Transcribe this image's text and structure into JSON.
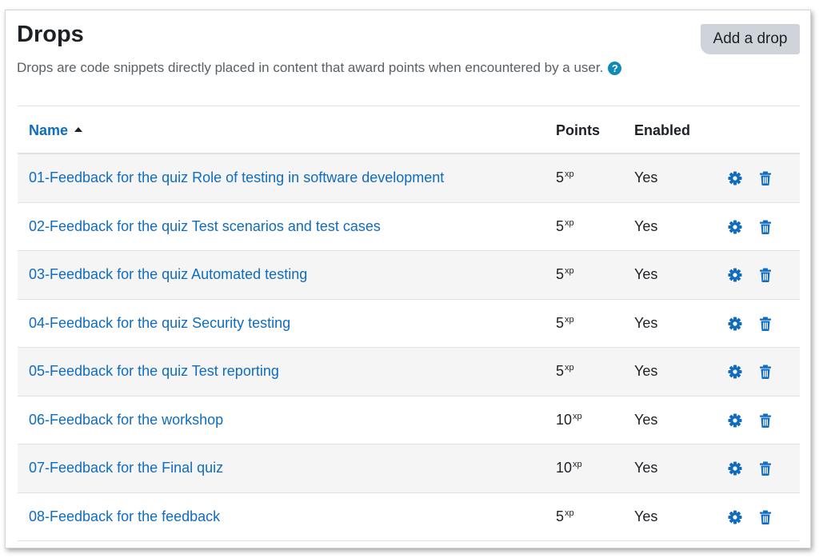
{
  "page": {
    "title": "Drops",
    "add_button": "Add a drop",
    "description": "Drops are code snippets directly placed in content that award points when encountered by a user.",
    "help_icon": "question-circle-icon"
  },
  "table": {
    "headers": {
      "name": "Name",
      "points": "Points",
      "enabled": "Enabled"
    },
    "sort": {
      "column": "name",
      "direction": "ascending"
    },
    "points_unit": "xp",
    "rows": [
      {
        "name": "01-Feedback for the quiz Role of testing in software development",
        "points": "5",
        "enabled": "Yes"
      },
      {
        "name": "02-Feedback for the quiz Test scenarios and test cases",
        "points": "5",
        "enabled": "Yes"
      },
      {
        "name": "03-Feedback for the quiz Automated testing",
        "points": "5",
        "enabled": "Yes"
      },
      {
        "name": "04-Feedback for the quiz Security testing",
        "points": "5",
        "enabled": "Yes"
      },
      {
        "name": "05-Feedback for the quiz Test reporting",
        "points": "5",
        "enabled": "Yes"
      },
      {
        "name": "06-Feedback for the workshop",
        "points": "10",
        "enabled": "Yes"
      },
      {
        "name": "07-Feedback for the Final quiz",
        "points": "10",
        "enabled": "Yes"
      },
      {
        "name": "08-Feedback for the feedback",
        "points": "5",
        "enabled": "Yes"
      }
    ],
    "row_actions": [
      "gear-icon",
      "trash-icon"
    ]
  },
  "colors": {
    "link": "#0f6cbf",
    "icon": "#0f6cbf",
    "help": "#0f8bb5",
    "button_bg": "#ced4da",
    "row_stripe": "#f5f5f5"
  }
}
